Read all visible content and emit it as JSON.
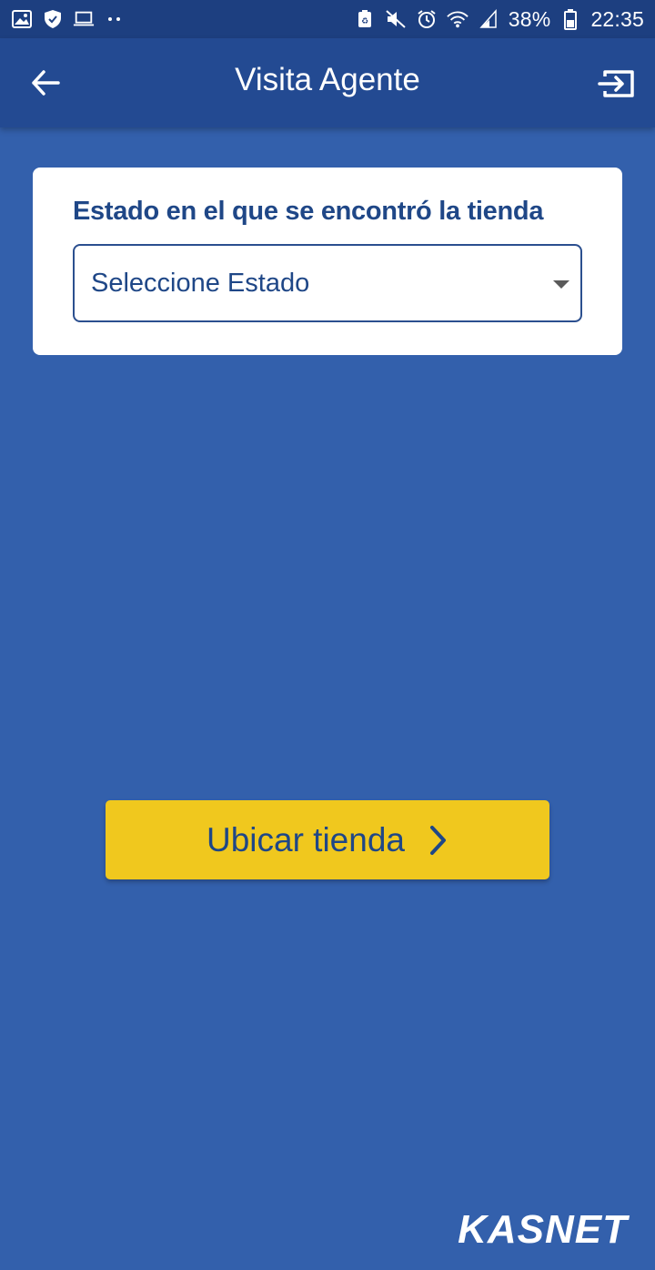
{
  "status_bar": {
    "battery_percent": "38%",
    "time": "22:35",
    "left_icons": [
      "gallery-icon",
      "shield-icon",
      "laptop-icon",
      "more-dots-icon"
    ],
    "right_icons": [
      "data-saver-icon",
      "mute-icon",
      "alarm-icon",
      "wifi-icon",
      "signal-icon",
      "battery-icon"
    ]
  },
  "app_bar": {
    "title": "Visita Agente",
    "back_icon": "arrow-left-icon",
    "exit_icon": "exit-icon"
  },
  "form": {
    "label": "Estado en el que se encontró la tienda",
    "select_value": "Seleccione Estado"
  },
  "actions": {
    "locate_label": "Ubicar tienda"
  },
  "brand": {
    "logo_text": "KASNET"
  },
  "colors": {
    "background": "#3360ac",
    "app_bar": "#234a92",
    "accent_button": "#f0c81e",
    "text_primary": "#1f4787"
  }
}
